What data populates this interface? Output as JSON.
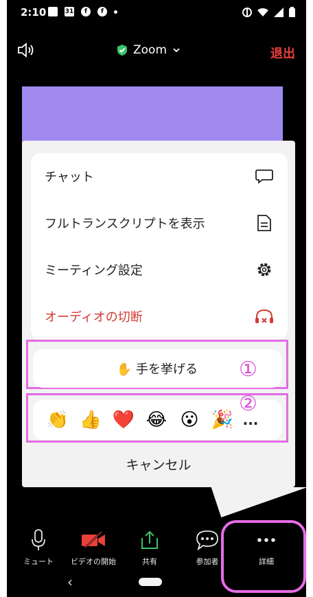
{
  "status_bar": {
    "time": "2:10",
    "calendar_label": "31"
  },
  "top_bar": {
    "title": "Zoom",
    "leave_label": "退出"
  },
  "menu": {
    "items": [
      {
        "label": "チャット",
        "icon": "chat-bubble-icon"
      },
      {
        "label": "フルトランスクリプトを表示",
        "icon": "document-icon"
      },
      {
        "label": "ミーティング設定",
        "icon": "gear-icon"
      },
      {
        "label": "オーディオの切断",
        "icon": "headphones-disconnect-icon",
        "color": "#d33a33"
      }
    ],
    "raise_hand_label": "✋ 手を挙げる",
    "annotation_1": "①",
    "annotation_2": "②",
    "reactions": [
      "👏",
      "👍",
      "❤️",
      "😂",
      "😮",
      "🎉"
    ],
    "more_label": "...",
    "cancel_label": "キャンセル"
  },
  "toolbar": {
    "items": [
      {
        "label": "ミュート",
        "icon": "microphone-icon"
      },
      {
        "label": "ビデオの開始",
        "icon": "video-off-icon"
      },
      {
        "label": "共有",
        "icon": "share-icon"
      },
      {
        "label": "参加者",
        "icon": "participants-chat-icon"
      },
      {
        "label": "詳細",
        "icon": "more-dots-icon"
      }
    ]
  },
  "nav": {
    "back_symbol": "‹"
  },
  "colors": {
    "accent_red": "#e8403a",
    "highlight_pink": "#e36be3",
    "video_tile": "#a08af0",
    "shield_green": "#3cc46b"
  }
}
